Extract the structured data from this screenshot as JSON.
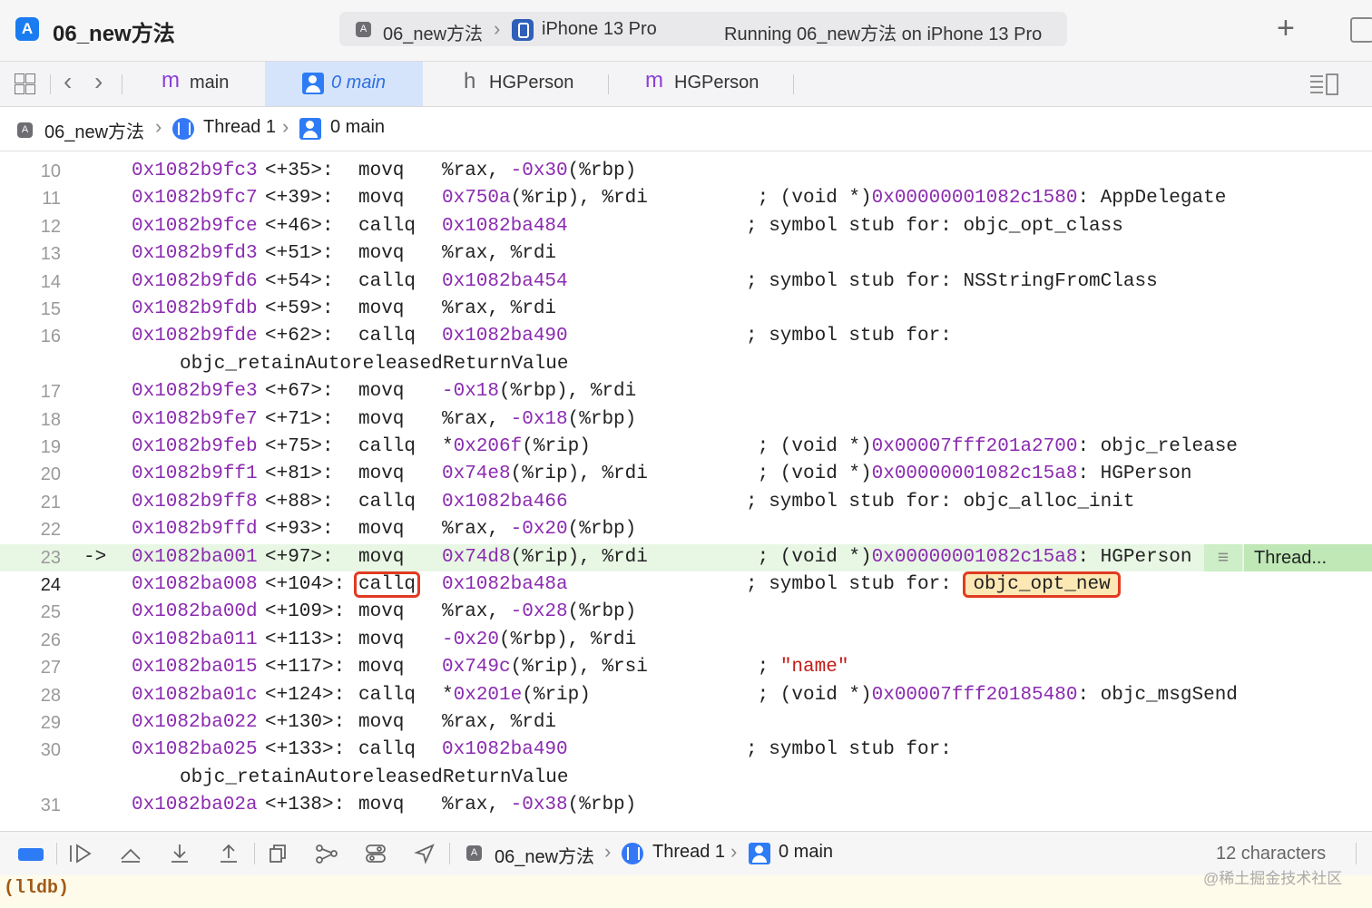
{
  "window": {
    "project_title": "06_new方法",
    "scheme": "06_new方法",
    "device": "iPhone 13 Pro",
    "status": "Running 06_new方法 on iPhone 13 Pro"
  },
  "tabs": [
    {
      "icon": "m",
      "label": "main"
    },
    {
      "icon": "stack-frame",
      "label": "0 main",
      "selected": true
    },
    {
      "icon": "h",
      "label": "HGPerson"
    },
    {
      "icon": "m",
      "label": "HGPerson"
    }
  ],
  "jumpbar": {
    "project": "06_new方法",
    "thread": "Thread 1",
    "frame": "0 main"
  },
  "code_lines": [
    {
      "n": "10",
      "addr": "0x1082b9fc3",
      "off": "<+35>:",
      "mn": "movq",
      "ops": [
        [
          "%rax, ",
          ""
        ],
        [
          "-0x30",
          "p"
        ],
        [
          "(%rbp)",
          ""
        ]
      ],
      "cmt": []
    },
    {
      "n": "11",
      "addr": "0x1082b9fc7",
      "off": "<+39>:",
      "mn": "movq",
      "ops": [
        [
          "0x750a",
          "p"
        ],
        [
          "(%rip), %rdi",
          ""
        ]
      ],
      "cmt": [
        [
          " ; (void *)",
          ""
        ],
        [
          "0x00000001082c1580",
          "p"
        ],
        [
          ": AppDelegate",
          ""
        ]
      ]
    },
    {
      "n": "12",
      "addr": "0x1082b9fce",
      "off": "<+46>:",
      "mn": "callq",
      "ops": [
        [
          "0x1082ba484",
          "p"
        ]
      ],
      "cmt": [
        [
          "; symbol stub for: objc_opt_class",
          ""
        ]
      ]
    },
    {
      "n": "13",
      "addr": "0x1082b9fd3",
      "off": "<+51>:",
      "mn": "movq",
      "ops": [
        [
          "%rax, %rdi",
          ""
        ]
      ],
      "cmt": []
    },
    {
      "n": "14",
      "addr": "0x1082b9fd6",
      "off": "<+54>:",
      "mn": "callq",
      "ops": [
        [
          "0x1082ba454",
          "p"
        ]
      ],
      "cmt": [
        [
          "; symbol stub for: NSStringFromClass",
          ""
        ]
      ]
    },
    {
      "n": "15",
      "addr": "0x1082b9fdb",
      "off": "<+59>:",
      "mn": "movq",
      "ops": [
        [
          "%rax, %rdi",
          ""
        ]
      ],
      "cmt": []
    },
    {
      "n": "16",
      "addr": "0x1082b9fde",
      "off": "<+62>:",
      "mn": "callq",
      "ops": [
        [
          "0x1082ba490",
          "p"
        ]
      ],
      "cmt": [
        [
          "; symbol stub for:",
          ""
        ]
      ]
    },
    {
      "n": "",
      "cont": "objc_retainAutoreleasedReturnValue"
    },
    {
      "n": "17",
      "addr": "0x1082b9fe3",
      "off": "<+67>:",
      "mn": "movq",
      "ops": [
        [
          "-0x18",
          "p"
        ],
        [
          "(%rbp), %rdi",
          ""
        ]
      ],
      "cmt": []
    },
    {
      "n": "18",
      "addr": "0x1082b9fe7",
      "off": "<+71>:",
      "mn": "movq",
      "ops": [
        [
          "%rax, ",
          ""
        ],
        [
          "-0x18",
          "p"
        ],
        [
          "(%rbp)",
          ""
        ]
      ],
      "cmt": []
    },
    {
      "n": "19",
      "addr": "0x1082b9feb",
      "off": "<+75>:",
      "mn": "callq",
      "ops": [
        [
          "*",
          ""
        ],
        [
          "0x206f",
          "p"
        ],
        [
          "(%rip)",
          ""
        ]
      ],
      "cmt": [
        [
          " ; (void *)",
          ""
        ],
        [
          "0x00007fff201a2700",
          "p"
        ],
        [
          ": objc_release",
          ""
        ]
      ]
    },
    {
      "n": "20",
      "addr": "0x1082b9ff1",
      "off": "<+81>:",
      "mn": "movq",
      "ops": [
        [
          "0x74e8",
          "p"
        ],
        [
          "(%rip), %rdi",
          ""
        ]
      ],
      "cmt": [
        [
          " ; (void *)",
          ""
        ],
        [
          "0x00000001082c15a8",
          "p"
        ],
        [
          ": HGPerson",
          ""
        ]
      ]
    },
    {
      "n": "21",
      "addr": "0x1082b9ff8",
      "off": "<+88>:",
      "mn": "callq",
      "ops": [
        [
          "0x1082ba466",
          "p"
        ]
      ],
      "cmt": [
        [
          "; symbol stub for: objc_alloc_init",
          ""
        ]
      ]
    },
    {
      "n": "22",
      "addr": "0x1082b9ffd",
      "off": "<+93>:",
      "mn": "movq",
      "ops": [
        [
          "%rax, ",
          ""
        ],
        [
          "-0x20",
          "p"
        ],
        [
          "(%rbp)",
          ""
        ]
      ],
      "cmt": []
    },
    {
      "n": "23",
      "arrow": "->",
      "addr": "0x1082ba001",
      "off": "<+97>:",
      "mn": "movq",
      "ops": [
        [
          "0x74d8",
          "p"
        ],
        [
          "(%rip), %rdi",
          ""
        ]
      ],
      "cmt": [
        [
          " ; (void *)",
          ""
        ],
        [
          "0x00000001082c15a8",
          "p"
        ],
        [
          ": HGPerson",
          ""
        ]
      ],
      "current": true,
      "badge": "Thread..."
    },
    {
      "n": "24",
      "addr": "0x1082ba008",
      "off": "<+104>:",
      "mn": "callq",
      "mn_boxed": true,
      "ops": [
        [
          "0x1082ba48a",
          "p"
        ]
      ],
      "cmt": [
        [
          "; symbol stub for: ",
          ""
        ]
      ],
      "sym_boxed": "objc_opt_new"
    },
    {
      "n": "25",
      "addr": "0x1082ba00d",
      "off": "<+109>:",
      "mn": "movq",
      "ops": [
        [
          "%rax, ",
          ""
        ],
        [
          "-0x28",
          "p"
        ],
        [
          "(%rbp)",
          ""
        ]
      ],
      "cmt": []
    },
    {
      "n": "26",
      "addr": "0x1082ba011",
      "off": "<+113>:",
      "mn": "movq",
      "ops": [
        [
          "-0x20",
          "p"
        ],
        [
          "(%rbp), %rdi",
          ""
        ]
      ],
      "cmt": []
    },
    {
      "n": "27",
      "addr": "0x1082ba015",
      "off": "<+117>:",
      "mn": "movq",
      "ops": [
        [
          "0x749c",
          "p"
        ],
        [
          "(%rip), %rsi",
          ""
        ]
      ],
      "cmt": [
        [
          " ; ",
          ""
        ],
        [
          "\"name\"",
          "s"
        ]
      ]
    },
    {
      "n": "28",
      "addr": "0x1082ba01c",
      "off": "<+124>:",
      "mn": "callq",
      "ops": [
        [
          "*",
          ""
        ],
        [
          "0x201e",
          "p"
        ],
        [
          "(%rip)",
          ""
        ]
      ],
      "cmt": [
        [
          " ; (void *)",
          ""
        ],
        [
          "0x00007fff20185480",
          "p"
        ],
        [
          ": objc_msgSend",
          ""
        ]
      ]
    },
    {
      "n": "29",
      "addr": "0x1082ba022",
      "off": "<+130>:",
      "mn": "movq",
      "ops": [
        [
          "%rax, %rdi",
          ""
        ]
      ],
      "cmt": []
    },
    {
      "n": "30",
      "addr": "0x1082ba025",
      "off": "<+133>:",
      "mn": "callq",
      "ops": [
        [
          "0x1082ba490",
          "p"
        ]
      ],
      "cmt": [
        [
          "; symbol stub for:",
          ""
        ]
      ]
    },
    {
      "n": "",
      "cont": "objc_retainAutoreleasedReturnValue"
    },
    {
      "n": "31",
      "addr": "0x1082ba02a",
      "off": "<+138>:",
      "mn": "movq",
      "ops": [
        [
          "%rax, ",
          ""
        ],
        [
          "-0x38",
          "p"
        ],
        [
          "(%rbp)",
          ""
        ]
      ],
      "cmt": []
    }
  ],
  "debug_bar": {
    "project": "06_new方法",
    "thread": "Thread 1",
    "frame": "0 main",
    "char_count": "12 characters"
  },
  "console": {
    "prompt": "(lldb)",
    "watermark": "@稀土掘金技术社区"
  },
  "colors": {
    "address": "#8b2bb0",
    "string": "#c41a16",
    "current_line": "#e8f6e4",
    "annotation_box": "#e13b22",
    "symbol_highlight": "#fbe8b4"
  }
}
